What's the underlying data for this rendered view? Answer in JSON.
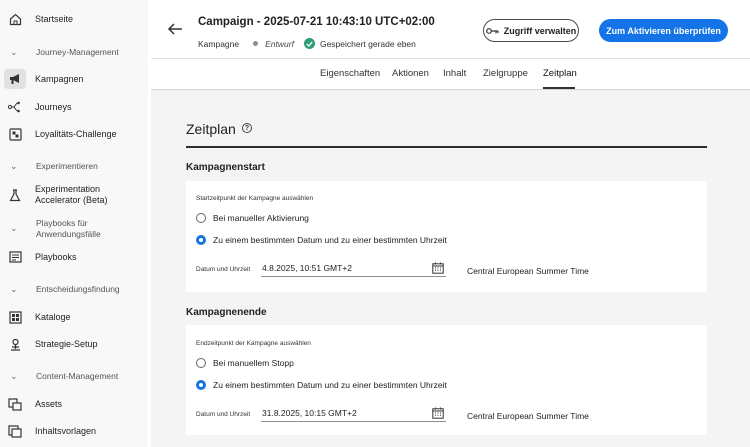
{
  "sidebar": {
    "home": "Startseite",
    "sec_journey": "Journey-Management",
    "campaigns": "Kampagnen",
    "journeys": "Journeys",
    "loyalty": "Loyalitäts-Challenge",
    "sec_experiment": "Experimentieren",
    "accelerator": "Experimentation Accelerator (Beta)",
    "sec_playbooks": "Playbooks für Anwendungsfälle",
    "playbooks": "Playbooks",
    "sec_decision": "Entscheidungsfindung",
    "catalogs": "Kataloge",
    "strategy": "Strategie-Setup",
    "sec_content": "Content-Management",
    "assets": "Assets",
    "templates": "Inhaltsvorlagen"
  },
  "header": {
    "title": "Campaign - 2025-07-21 10:43:10 UTC+02:00",
    "type": "Kampagne",
    "status": "Entwurf",
    "saved": "Gespeichert gerade eben",
    "manage_access": "Zugriff verwalten",
    "review_activate": "Zum Aktivieren überprüfen"
  },
  "tabs": [
    "Eigenschaften",
    "Aktionen",
    "Inhalt",
    "Zielgruppe",
    "Zeitplan"
  ],
  "active_tab": "Zeitplan",
  "page_title": "Zeitplan",
  "start": {
    "heading": "Kampagnenstart",
    "label": "Startzeitpunkt der Kampagne auswählen",
    "option_manual": "Bei manueller Aktivierung",
    "option_date": "Zu einem bestimmten Datum und zu einer bestimmten Uhrzeit",
    "selected": "option_date",
    "dt_label": "Datum und Uhrzeit",
    "dt_value": "4.8.2025, 10:51  GMT+2",
    "timezone": "Central European Summer Time"
  },
  "end": {
    "heading": "Kampagnenende",
    "label": "Endzeitpunkt der Kampagne auswählen",
    "option_manual": "Bei manuellem Stopp",
    "option_date": "Zu einem bestimmten Datum und zu einer bestimmten Uhrzeit",
    "selected": "option_date",
    "dt_label": "Datum und Uhrzeit",
    "dt_value": "31.8.2025, 10:15  GMT+2",
    "timezone": "Central European Summer Time"
  },
  "colors": {
    "accent": "#1473e6",
    "success": "#2d9d78",
    "panel": "#f4f4f4"
  }
}
